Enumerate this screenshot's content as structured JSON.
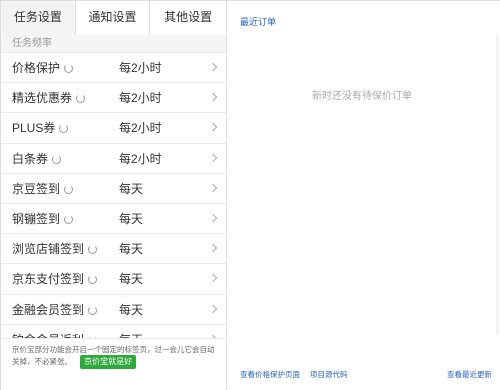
{
  "tabs": [
    {
      "label": "任务设置"
    },
    {
      "label": "通知设置"
    },
    {
      "label": "其他设置"
    }
  ],
  "section": {
    "label": "任务频率"
  },
  "tasks": [
    {
      "name": "价格保护",
      "freq": "每2小时"
    },
    {
      "name": "精选优惠券",
      "freq": "每2小时"
    },
    {
      "name": "PLUS券",
      "freq": "每2小时"
    },
    {
      "name": "白条券",
      "freq": "每2小时"
    },
    {
      "name": "京豆签到",
      "freq": "每天"
    },
    {
      "name": "钢镚签到",
      "freq": "每天"
    },
    {
      "name": "浏览店铺签到",
      "freq": "每天"
    },
    {
      "name": "京东支付签到",
      "freq": "每天"
    },
    {
      "name": "金融会员签到",
      "freq": "每天"
    },
    {
      "name": "铂金会员返利",
      "freq": "每天"
    }
  ],
  "notice": {
    "text": "京价宝部分功能会开启一个固定的标签页，过一会儿它会自动关掉，不必紧张。",
    "button_label": "京价宝就是好"
  },
  "right": {
    "title": "最近订单",
    "empty_message": "新时还没有待保价订单",
    "link_check": "查看价格保护页面",
    "link_source": "项目源代码",
    "link_updates": "查看最近更新"
  },
  "colors": {
    "accent_link": "#2b62c8",
    "button_green": "#2eaa3c"
  }
}
